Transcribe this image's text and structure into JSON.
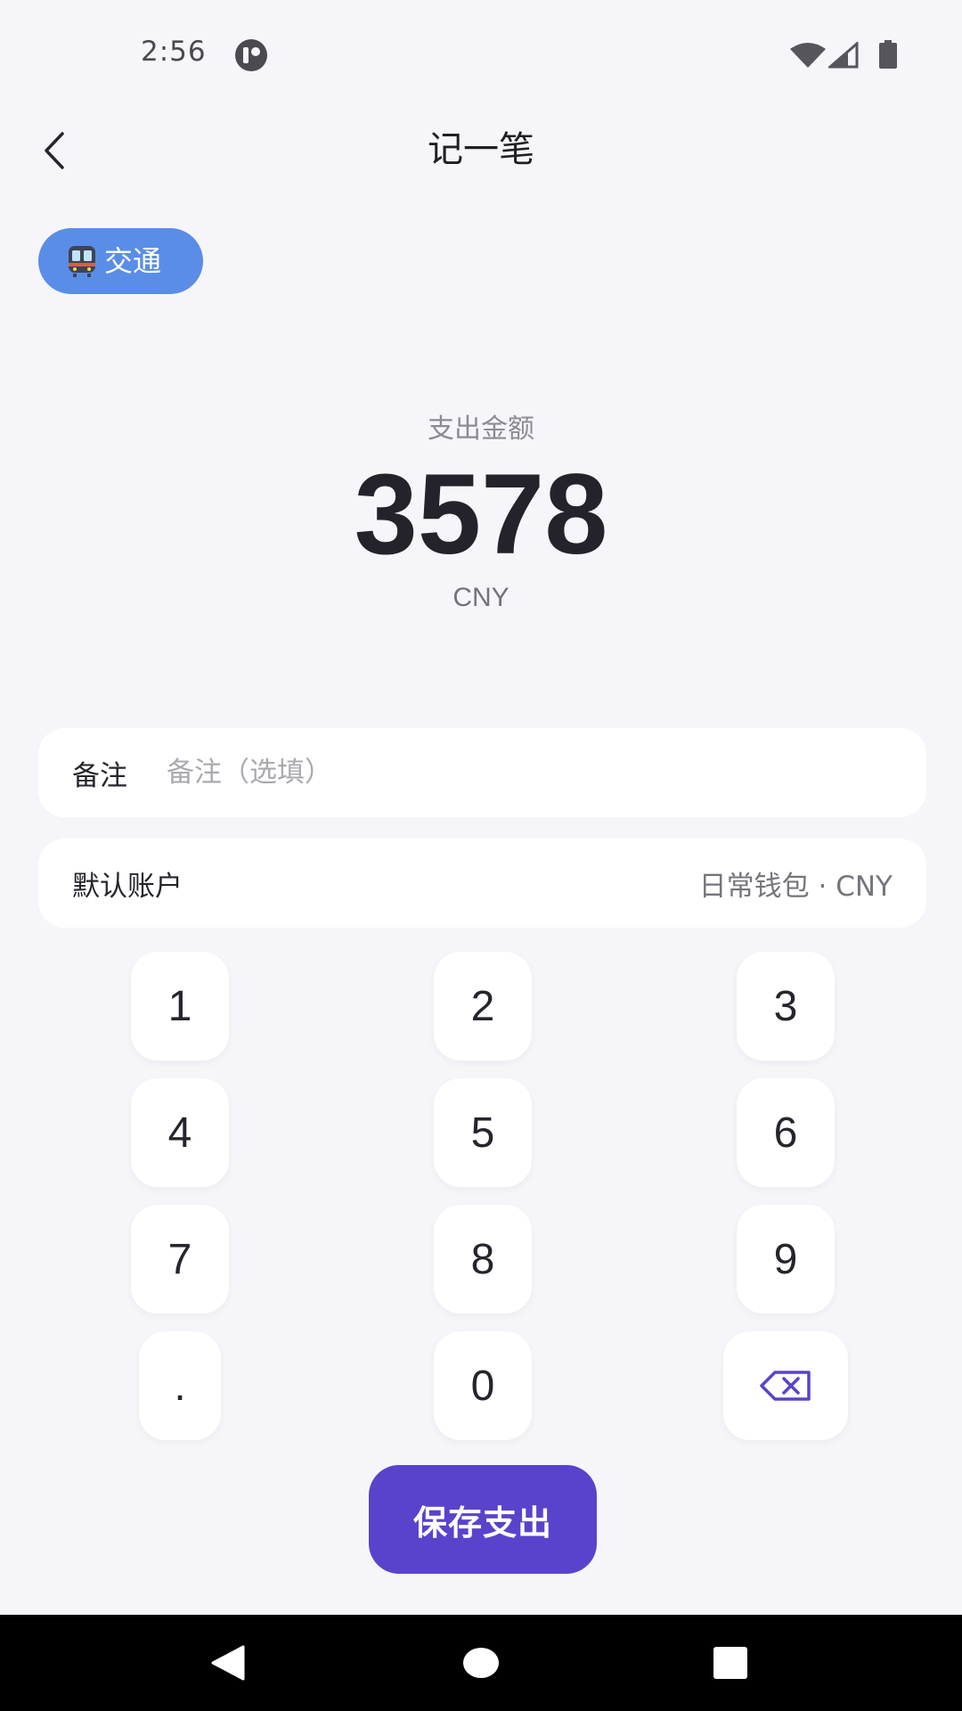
{
  "status_bar": {
    "time": "2:56"
  },
  "header": {
    "title": "记一笔"
  },
  "category": {
    "label": "交通",
    "icon": "metro-train-icon",
    "color": "#5a8de8"
  },
  "amount": {
    "label": "支出金额",
    "value": "3578",
    "currency": "CNY"
  },
  "note": {
    "label": "备注",
    "placeholder": "备注（选填）",
    "value": ""
  },
  "account": {
    "label": "默认账户",
    "value": "日常钱包 · CNY"
  },
  "keypad": {
    "keys": [
      "1",
      "2",
      "3",
      "4",
      "5",
      "6",
      "7",
      "8",
      "9",
      ".",
      "0"
    ],
    "backspace_icon": "backspace-icon"
  },
  "save_button": {
    "label": "保存支出",
    "color": "#5a43cc"
  },
  "nav_bar": {
    "back_icon": "triangle-back-icon",
    "home_icon": "circle-home-icon",
    "recents_icon": "square-recents-icon"
  }
}
